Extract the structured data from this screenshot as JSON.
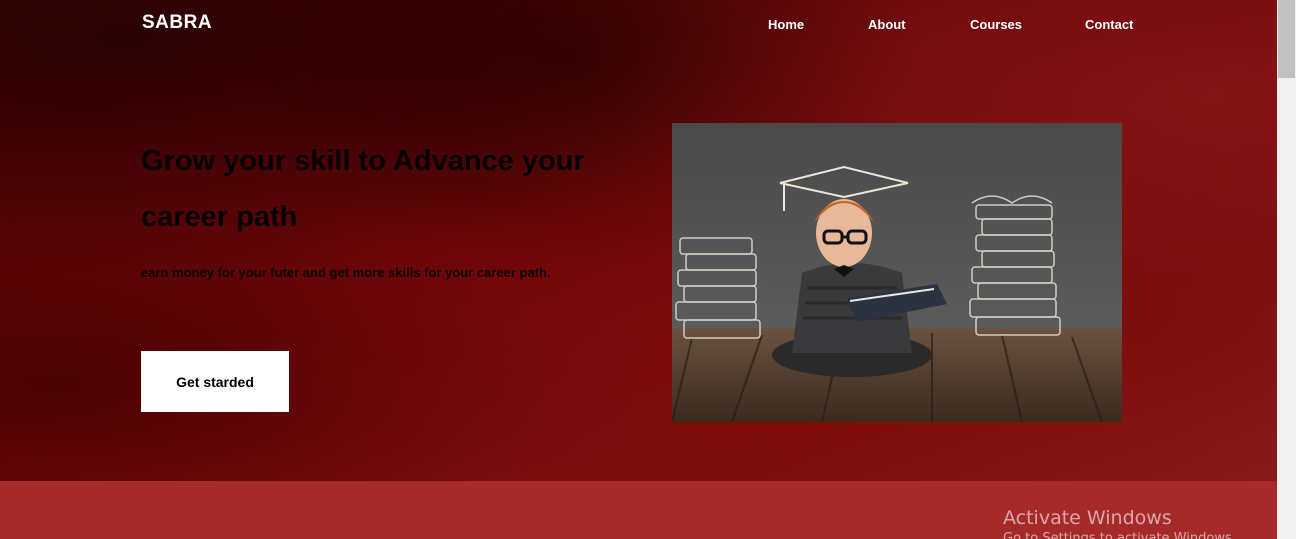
{
  "header": {
    "brand": "SABRA",
    "nav": [
      "Home",
      "About",
      "Courses",
      "Contact"
    ]
  },
  "hero": {
    "headline": "Grow your skill to Advance your career path",
    "subtext": "earn money for your futer and get more skills for your career path.",
    "cta_label": "Get starded"
  },
  "watermark": {
    "title": "Activate Windows",
    "subtitle": "Go to Settings to activate Windows."
  },
  "colors": {
    "hero_background": "#6b0508",
    "band": "#a72a2a",
    "cta_background": "#ffffff"
  }
}
